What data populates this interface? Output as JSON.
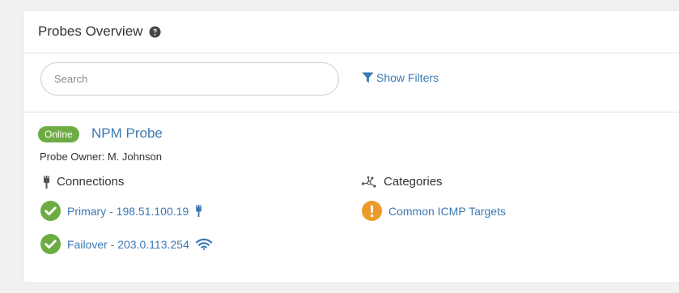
{
  "panel": {
    "title": "Probes Overview",
    "help_icon": "question-circle-icon"
  },
  "search": {
    "placeholder": "Search",
    "value": ""
  },
  "filters": {
    "label": "Show Filters",
    "icon": "filter-funnel-icon"
  },
  "probe": {
    "status": "Online",
    "name": "NPM Probe",
    "owner": "Probe Owner: M. Johnson"
  },
  "connections": {
    "heading": "Connections",
    "heading_icon": "ethernet-plug-icon",
    "items": [
      {
        "label": "Primary - 198.51.100.19",
        "status_icon": "check-circle-icon",
        "type_icon": "ethernet-plug-icon"
      },
      {
        "label": "Failover - 203.0.113.254",
        "status_icon": "check-circle-icon",
        "type_icon": "wifi-icon"
      }
    ]
  },
  "categories": {
    "heading": "Categories",
    "heading_icon": "network-nodes-icon",
    "items": [
      {
        "label": "Common ICMP Targets",
        "status_icon": "warning-circle-icon"
      }
    ]
  },
  "colors": {
    "link": "#3c79b3",
    "success": "#6dac43",
    "warning": "#ec9b2b",
    "text": "#333333",
    "border": "#e3e3e3"
  }
}
